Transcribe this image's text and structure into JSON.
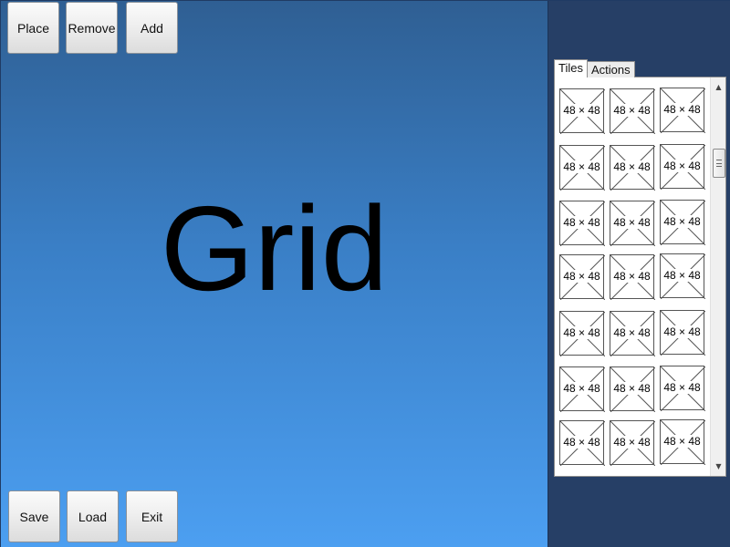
{
  "canvas": {
    "label": "Grid"
  },
  "toolbar": {
    "place_label": "Place",
    "remove_label": "Remove",
    "add_label": "Add"
  },
  "tabs": [
    {
      "label": "Tiles"
    },
    {
      "label": "Actions"
    }
  ],
  "tiles": {
    "rows": [
      [
        "48 × 48",
        "48 × 48",
        "48 × 48"
      ],
      [
        "48 × 48",
        "48 × 48",
        "48 × 48"
      ],
      [
        "48 × 48",
        "48 × 48",
        "48 × 48"
      ],
      [
        "48 × 48",
        "48 × 48",
        "48 × 48"
      ],
      [
        "48 × 48",
        "48 × 48",
        "48 × 48"
      ],
      [
        "48 × 48",
        "48 × 48",
        "48 × 48"
      ],
      [
        "48 × 48",
        "48 × 48",
        "48 × 48"
      ]
    ]
  },
  "scrollbar": {
    "up_icon": "scroll-up-arrow-icon",
    "down_icon": "scroll-down-arrow-icon"
  },
  "footer": {
    "save_label": "Save",
    "load_label": "Load",
    "exit_label": "Exit"
  }
}
